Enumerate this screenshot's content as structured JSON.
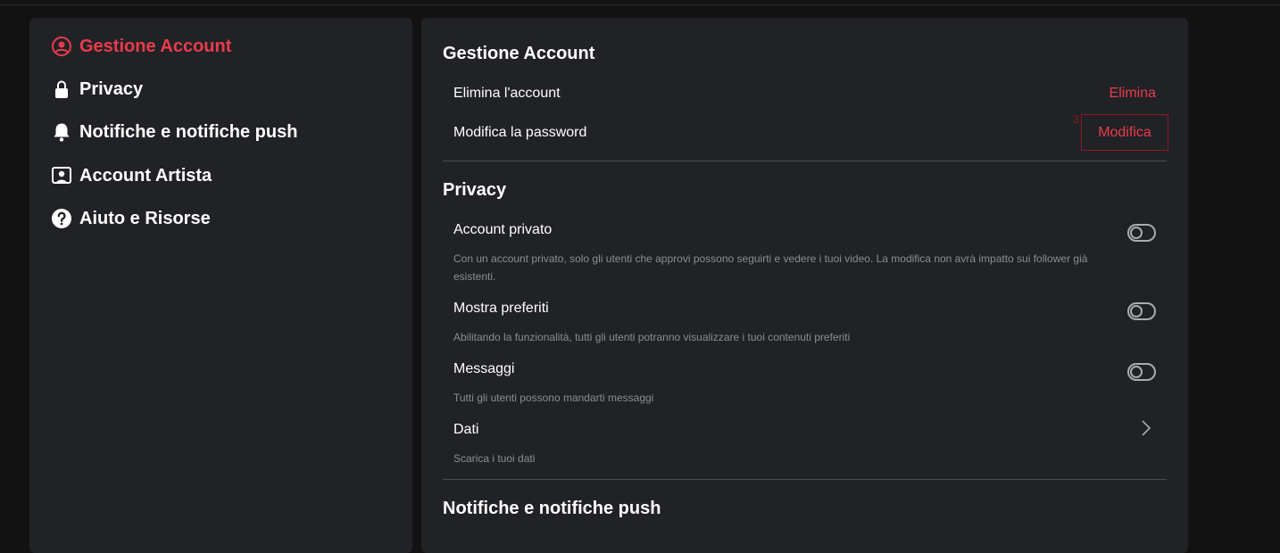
{
  "sidebar": {
    "items": [
      {
        "label": "Gestione Account",
        "icon": "user-circle-icon",
        "active": true
      },
      {
        "label": "Privacy",
        "icon": "lock-icon",
        "active": false
      },
      {
        "label": "Notifiche e notifiche push",
        "icon": "bell-icon",
        "active": false
      },
      {
        "label": "Account Artista",
        "icon": "artist-account-icon",
        "active": false
      },
      {
        "label": "Aiuto e Risorse",
        "icon": "help-circle-icon",
        "active": false
      }
    ]
  },
  "main": {
    "account_section": {
      "title": "Gestione Account",
      "delete_label": "Elimina l'account",
      "delete_action": "Elimina",
      "password_label": "Modifica la password",
      "password_action": "Modifica",
      "badge": "3"
    },
    "privacy_section": {
      "title": "Privacy",
      "rows": [
        {
          "label": "Account privato",
          "desc": "Con un account privato, solo gli utenti che approvi possono seguirti e vedere i tuoi video. La modifica non avrà impatto sui follower già esistenti.",
          "toggle_on": false
        },
        {
          "label": "Mostra preferiti",
          "desc": "Abilitando la funzionalità, tutti gli utenti potranno visualizzare i tuoi contenuti preferiti",
          "toggle_on": false
        },
        {
          "label": "Messaggi",
          "desc": "Tutti gli utenti possono mandarti messaggi",
          "toggle_on": false
        },
        {
          "label": "Dati",
          "desc": "Scarica i tuoi dati"
        }
      ]
    },
    "notifications_section": {
      "title": "Notifiche e notifiche push"
    }
  },
  "colors": {
    "accent": "#ea3b4b",
    "panel": "#202226",
    "background": "#121212",
    "muted_text": "#8b8d92"
  }
}
